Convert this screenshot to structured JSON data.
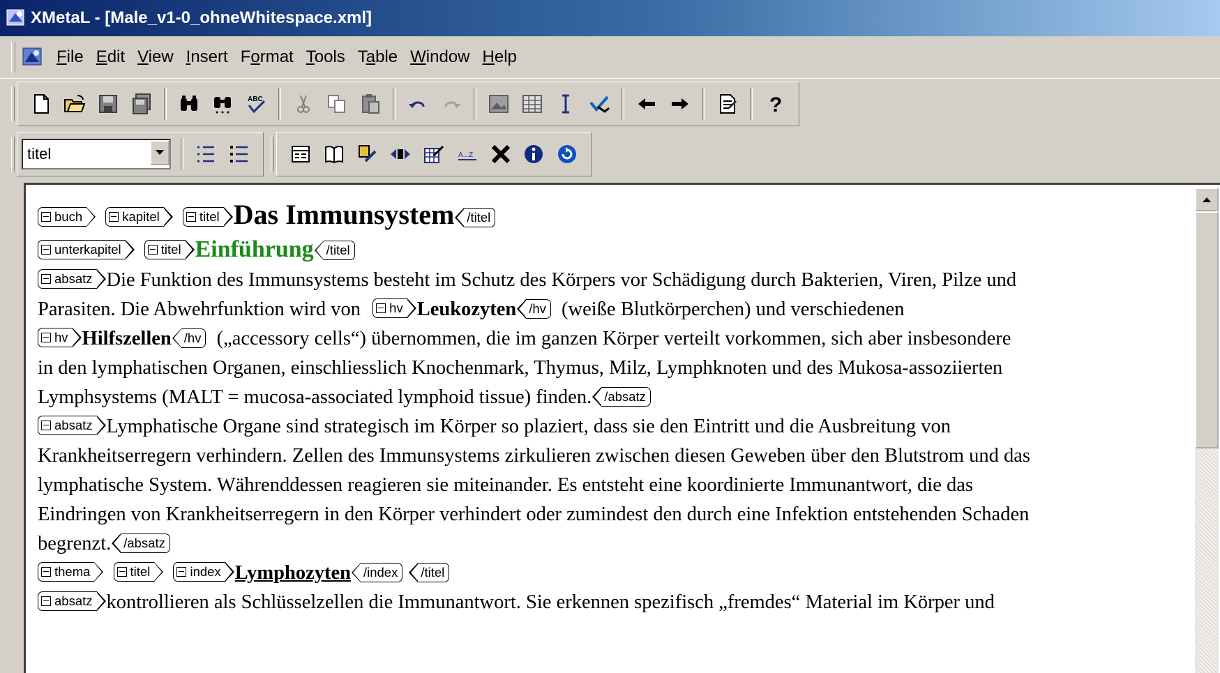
{
  "window": {
    "title": "XMetaL - [Male_v1-0_ohneWhitespace.xml]"
  },
  "menu": {
    "items": [
      {
        "pre": "",
        "u": "F",
        "post": "ile"
      },
      {
        "pre": "",
        "u": "E",
        "post": "dit"
      },
      {
        "pre": "",
        "u": "V",
        "post": "iew"
      },
      {
        "pre": "",
        "u": "I",
        "post": "nsert"
      },
      {
        "pre": "F",
        "u": "o",
        "post": "rmat"
      },
      {
        "pre": "",
        "u": "T",
        "post": "ools"
      },
      {
        "pre": "T",
        "u": "a",
        "post": "ble"
      },
      {
        "pre": "",
        "u": "W",
        "post": "indow"
      },
      {
        "pre": "",
        "u": "H",
        "post": "elp"
      }
    ]
  },
  "toolbar": {
    "style_value": "titel",
    "main_icons": [
      "new-document-icon",
      "open-folder-icon",
      "save-icon",
      "save-all-icon",
      "find-icon",
      "find-replace-icon",
      "spell-check-icon",
      "cut-icon",
      "copy-icon",
      "paste-icon",
      "undo-icon",
      "redo-icon",
      "insert-image-icon",
      "insert-table-icon",
      "text-cursor-icon",
      "check-icon",
      "back-arrow-icon",
      "forward-arrow-icon",
      "properties-icon",
      "help-icon"
    ],
    "format_icons": [
      "numbered-list-icon",
      "bullet-list-icon",
      "form-icon",
      "book-icon",
      "edit-element-icon",
      "split-icon",
      "edit-table-icon",
      "sort-icon",
      "delete-icon",
      "info-icon",
      "refresh-icon"
    ]
  },
  "document": {
    "tags": {
      "buch": "buch",
      "kapitel": "kapitel",
      "titel": "titel",
      "titel_close": "/titel",
      "unterkapitel": "unterkapitel",
      "absatz": "absatz",
      "absatz_close": "/absatz",
      "hv": "hv",
      "hv_close": "/hv",
      "thema": "thema",
      "index": "index",
      "index_close": "/index"
    },
    "chapter_title": "Das Immunsystem",
    "subchapter_title": "Einführung",
    "p1": {
      "t1": "Die Funktion des Immunsystems besteht im Schutz des Körpers vor Schädigung durch Bakterien, Viren, Pilze und",
      "t2": "Parasiten. Die Abwehrfunktion wird von",
      "hv1": "Leukozyten",
      "t3": "(weiße Blutkörperchen) und verschiedenen",
      "hv2": "Hilfszellen",
      "t4": "(„accessory cells“) übernommen, die im ganzen Körper verteilt vorkommen, sich aber insbesondere",
      "t5": "in den lymphatischen Organen, einschliesslich Knochenmark, Thymus, Milz, Lymphknoten und des Mukosa-assoziierten",
      "t6": "Lymphsystems (MALT = mucosa-associated lymphoid tissue) finden."
    },
    "p2": {
      "t1": "Lymphatische Organe sind strategisch im Körper so plaziert, dass sie den Eintritt und die Ausbreitung von",
      "t2": "Krankheitserregern verhindern. Zellen des Immunsystems zirkulieren zwischen diesen Geweben über den Blutstrom und das",
      "t3": "lymphatische System. Währenddessen reagieren sie miteinander. Es entsteht eine koordinierte Immunantwort, die das",
      "t4": "Eindringen von Krankheitserregern in den Körper verhindert oder zumindest den durch eine Infektion entstehenden Schaden",
      "t5": "begrenzt."
    },
    "topic_title": "Lymphozyten",
    "p3": {
      "t1": "kontrollieren als Schlüsselzellen die Immunantwort. Sie erkennen spezifisch „fremdes“ Material im Körper und"
    }
  }
}
